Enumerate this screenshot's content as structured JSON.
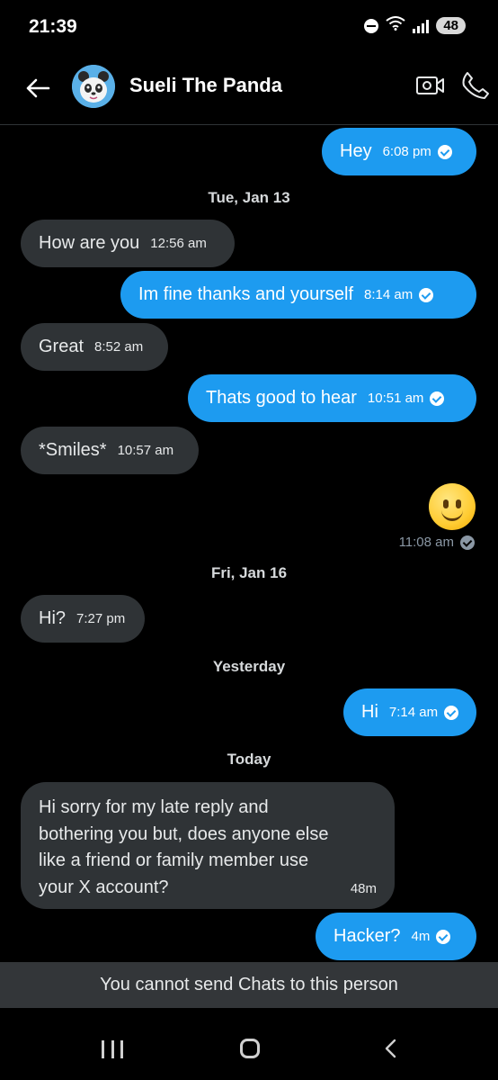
{
  "status_bar": {
    "time": "21:39",
    "battery": "48"
  },
  "header": {
    "contact_name": "Sueli The Panda"
  },
  "messages": [
    {
      "text": "Hey",
      "time": "6:08 pm",
      "direction": "out"
    },
    {
      "text": "How are you",
      "time": "12:56 am",
      "direction": "in"
    },
    {
      "text": "Im fine thanks and yourself",
      "time": "8:14 am",
      "direction": "out"
    },
    {
      "text": "Great",
      "time": "8:52 am",
      "direction": "in"
    },
    {
      "text": "Thats good to hear",
      "time": "10:51 am",
      "direction": "out"
    },
    {
      "text": "*Smiles*",
      "time": "10:57 am",
      "direction": "in"
    },
    {
      "text": "🙂",
      "time": "11:08 am",
      "direction": "out"
    },
    {
      "text": "Hi?",
      "time": "7:27 pm",
      "direction": "in"
    },
    {
      "text": "Hi",
      "time": "7:14 am",
      "direction": "out"
    },
    {
      "text": "Hi sorry for my late reply and\nbothering you but, does anyone else\nlike a friend or family member use\nyour X account?",
      "time": "48m",
      "direction": "in"
    },
    {
      "text": "Hacker?",
      "time": "4m",
      "direction": "out"
    }
  ],
  "date_separators": [
    "Tue, Jan 13",
    "Fri, Jan 16",
    "Yesterday",
    "Today"
  ],
  "blocked_notice": "You cannot send Chats to this person",
  "colors": {
    "outgoing_bubble": "#1d9bf0",
    "incoming_bubble": "#2f3336",
    "background": "#000000"
  }
}
